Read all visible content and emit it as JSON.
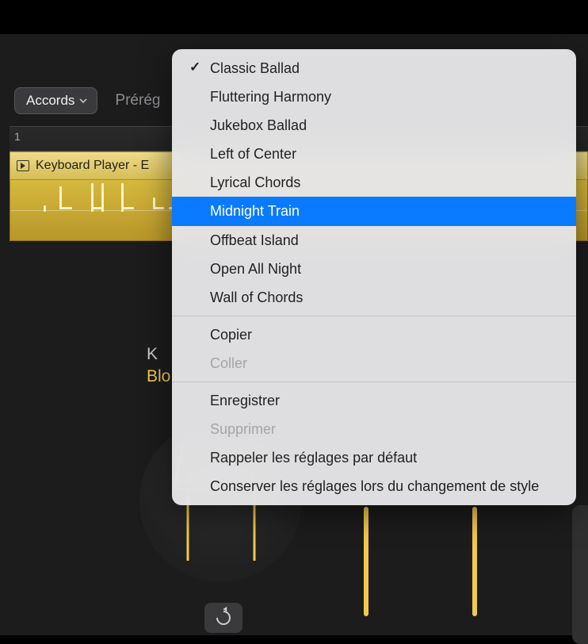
{
  "toolbar": {
    "chords_label": "Accords",
    "preset_label": "Prérég"
  },
  "ruler": {
    "mark": "1"
  },
  "track": {
    "title": "Keyboard Player - E"
  },
  "info": {
    "line1": "K",
    "line2": "Blo"
  },
  "menu": {
    "presets": [
      {
        "label": "Classic Ballad",
        "checked": true,
        "highlighted": false
      },
      {
        "label": "Fluttering Harmony",
        "checked": false,
        "highlighted": false
      },
      {
        "label": "Jukebox Ballad",
        "checked": false,
        "highlighted": false
      },
      {
        "label": "Left of Center",
        "checked": false,
        "highlighted": false
      },
      {
        "label": "Lyrical Chords",
        "checked": false,
        "highlighted": false
      },
      {
        "label": "Midnight Train",
        "checked": false,
        "highlighted": true
      },
      {
        "label": "Offbeat Island",
        "checked": false,
        "highlighted": false
      },
      {
        "label": "Open All Night",
        "checked": false,
        "highlighted": false
      },
      {
        "label": "Wall of Chords",
        "checked": false,
        "highlighted": false
      }
    ],
    "copy": "Copier",
    "paste": "Coller",
    "save": "Enregistrer",
    "delete": "Supprimer",
    "recall_defaults": "Rappeler les réglages par défaut",
    "keep_on_style_change": "Conserver les réglages lors du changement de style"
  }
}
